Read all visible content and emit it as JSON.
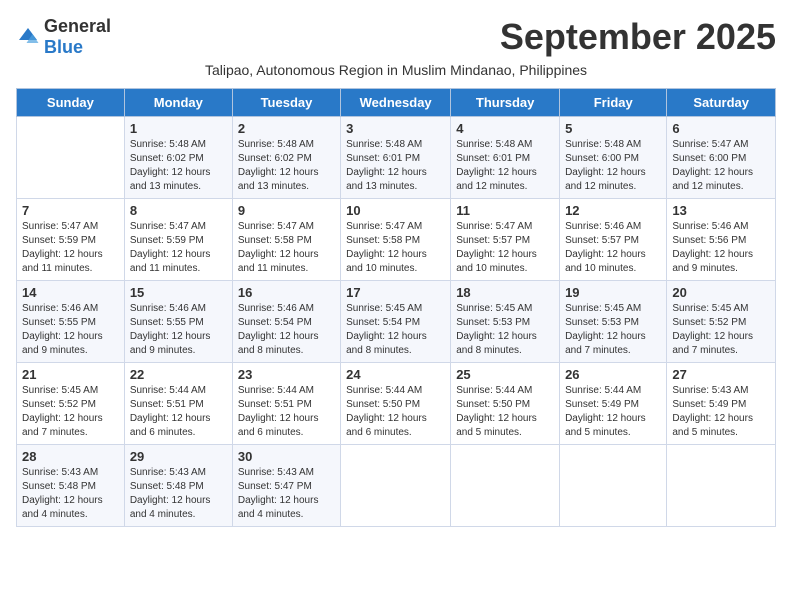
{
  "logo": {
    "general": "General",
    "blue": "Blue"
  },
  "title": "September 2025",
  "subtitle": "Talipao, Autonomous Region in Muslim Mindanao, Philippines",
  "header": {
    "days": [
      "Sunday",
      "Monday",
      "Tuesday",
      "Wednesday",
      "Thursday",
      "Friday",
      "Saturday"
    ]
  },
  "weeks": [
    [
      {
        "day": "",
        "info": ""
      },
      {
        "day": "1",
        "info": "Sunrise: 5:48 AM\nSunset: 6:02 PM\nDaylight: 12 hours\nand 13 minutes."
      },
      {
        "day": "2",
        "info": "Sunrise: 5:48 AM\nSunset: 6:02 PM\nDaylight: 12 hours\nand 13 minutes."
      },
      {
        "day": "3",
        "info": "Sunrise: 5:48 AM\nSunset: 6:01 PM\nDaylight: 12 hours\nand 13 minutes."
      },
      {
        "day": "4",
        "info": "Sunrise: 5:48 AM\nSunset: 6:01 PM\nDaylight: 12 hours\nand 12 minutes."
      },
      {
        "day": "5",
        "info": "Sunrise: 5:48 AM\nSunset: 6:00 PM\nDaylight: 12 hours\nand 12 minutes."
      },
      {
        "day": "6",
        "info": "Sunrise: 5:47 AM\nSunset: 6:00 PM\nDaylight: 12 hours\nand 12 minutes."
      }
    ],
    [
      {
        "day": "7",
        "info": "Sunrise: 5:47 AM\nSunset: 5:59 PM\nDaylight: 12 hours\nand 11 minutes."
      },
      {
        "day": "8",
        "info": "Sunrise: 5:47 AM\nSunset: 5:59 PM\nDaylight: 12 hours\nand 11 minutes."
      },
      {
        "day": "9",
        "info": "Sunrise: 5:47 AM\nSunset: 5:58 PM\nDaylight: 12 hours\nand 11 minutes."
      },
      {
        "day": "10",
        "info": "Sunrise: 5:47 AM\nSunset: 5:58 PM\nDaylight: 12 hours\nand 10 minutes."
      },
      {
        "day": "11",
        "info": "Sunrise: 5:47 AM\nSunset: 5:57 PM\nDaylight: 12 hours\nand 10 minutes."
      },
      {
        "day": "12",
        "info": "Sunrise: 5:46 AM\nSunset: 5:57 PM\nDaylight: 12 hours\nand 10 minutes."
      },
      {
        "day": "13",
        "info": "Sunrise: 5:46 AM\nSunset: 5:56 PM\nDaylight: 12 hours\nand 9 minutes."
      }
    ],
    [
      {
        "day": "14",
        "info": "Sunrise: 5:46 AM\nSunset: 5:55 PM\nDaylight: 12 hours\nand 9 minutes."
      },
      {
        "day": "15",
        "info": "Sunrise: 5:46 AM\nSunset: 5:55 PM\nDaylight: 12 hours\nand 9 minutes."
      },
      {
        "day": "16",
        "info": "Sunrise: 5:46 AM\nSunset: 5:54 PM\nDaylight: 12 hours\nand 8 minutes."
      },
      {
        "day": "17",
        "info": "Sunrise: 5:45 AM\nSunset: 5:54 PM\nDaylight: 12 hours\nand 8 minutes."
      },
      {
        "day": "18",
        "info": "Sunrise: 5:45 AM\nSunset: 5:53 PM\nDaylight: 12 hours\nand 8 minutes."
      },
      {
        "day": "19",
        "info": "Sunrise: 5:45 AM\nSunset: 5:53 PM\nDaylight: 12 hours\nand 7 minutes."
      },
      {
        "day": "20",
        "info": "Sunrise: 5:45 AM\nSunset: 5:52 PM\nDaylight: 12 hours\nand 7 minutes."
      }
    ],
    [
      {
        "day": "21",
        "info": "Sunrise: 5:45 AM\nSunset: 5:52 PM\nDaylight: 12 hours\nand 7 minutes."
      },
      {
        "day": "22",
        "info": "Sunrise: 5:44 AM\nSunset: 5:51 PM\nDaylight: 12 hours\nand 6 minutes."
      },
      {
        "day": "23",
        "info": "Sunrise: 5:44 AM\nSunset: 5:51 PM\nDaylight: 12 hours\nand 6 minutes."
      },
      {
        "day": "24",
        "info": "Sunrise: 5:44 AM\nSunset: 5:50 PM\nDaylight: 12 hours\nand 6 minutes."
      },
      {
        "day": "25",
        "info": "Sunrise: 5:44 AM\nSunset: 5:50 PM\nDaylight: 12 hours\nand 5 minutes."
      },
      {
        "day": "26",
        "info": "Sunrise: 5:44 AM\nSunset: 5:49 PM\nDaylight: 12 hours\nand 5 minutes."
      },
      {
        "day": "27",
        "info": "Sunrise: 5:43 AM\nSunset: 5:49 PM\nDaylight: 12 hours\nand 5 minutes."
      }
    ],
    [
      {
        "day": "28",
        "info": "Sunrise: 5:43 AM\nSunset: 5:48 PM\nDaylight: 12 hours\nand 4 minutes."
      },
      {
        "day": "29",
        "info": "Sunrise: 5:43 AM\nSunset: 5:48 PM\nDaylight: 12 hours\nand 4 minutes."
      },
      {
        "day": "30",
        "info": "Sunrise: 5:43 AM\nSunset: 5:47 PM\nDaylight: 12 hours\nand 4 minutes."
      },
      {
        "day": "",
        "info": ""
      },
      {
        "day": "",
        "info": ""
      },
      {
        "day": "",
        "info": ""
      },
      {
        "day": "",
        "info": ""
      }
    ]
  ]
}
